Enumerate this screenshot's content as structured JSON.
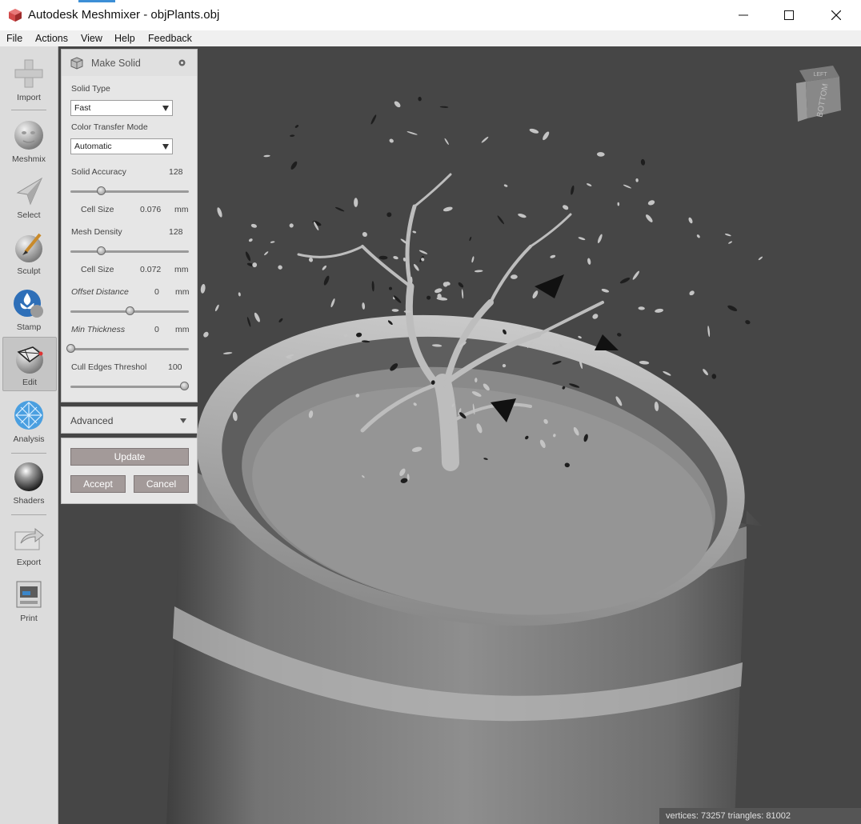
{
  "window": {
    "title": "Autodesk Meshmixer - objPlants.obj",
    "controls": [
      "minimize-icon",
      "maximize-icon",
      "close-icon"
    ]
  },
  "menu": [
    "File",
    "Actions",
    "View",
    "Help",
    "Feedback"
  ],
  "tools": [
    {
      "label": "Import",
      "icon": "plus-icon"
    },
    {
      "label": "Meshmix",
      "icon": "face-sphere-icon"
    },
    {
      "label": "Select",
      "icon": "cursor-arrow-icon"
    },
    {
      "label": "Sculpt",
      "icon": "brush-sphere-icon"
    },
    {
      "label": "Stamp",
      "icon": "stamp-fleur-icon"
    },
    {
      "label": "Edit",
      "icon": "edit-mesh-icon",
      "active": true
    },
    {
      "label": "Analysis",
      "icon": "analysis-mesh-icon"
    },
    {
      "label": "Shaders",
      "icon": "chrome-sphere-icon"
    },
    {
      "label": "Export",
      "icon": "export-arrow-icon"
    },
    {
      "label": "Print",
      "icon": "printer-icon"
    }
  ],
  "panel": {
    "title": "Make Solid",
    "solid_type": {
      "label": "Solid Type",
      "value": "Fast"
    },
    "color_transfer": {
      "label": "Color Transfer Mode",
      "value": "Automatic"
    },
    "solid_accuracy": {
      "label": "Solid Accuracy",
      "value": "128",
      "fraction": 0.26
    },
    "cell_size_1": {
      "label": "Cell Size",
      "value": "0.076",
      "unit": "mm"
    },
    "mesh_density": {
      "label": "Mesh Density",
      "value": "128",
      "fraction": 0.26
    },
    "cell_size_2": {
      "label": "Cell Size",
      "value": "0.072",
      "unit": "mm"
    },
    "offset_distance": {
      "label": "Offset Distance",
      "value": "0",
      "unit": "mm",
      "fraction": 0.5
    },
    "min_thickness": {
      "label": "Min Thickness",
      "value": "0",
      "unit": "mm",
      "fraction": 0.0
    },
    "cull_edges": {
      "label": "Cull Edges Threshol",
      "value": "100",
      "fraction": 0.96
    }
  },
  "advanced": {
    "label": "Advanced"
  },
  "actions": {
    "update": "Update",
    "accept": "Accept",
    "cancel": "Cancel"
  },
  "viewcube": {
    "top_label": "LEFT",
    "face_label": "BOTTOM"
  },
  "status": "vertices: 73257  triangles: 81002"
}
